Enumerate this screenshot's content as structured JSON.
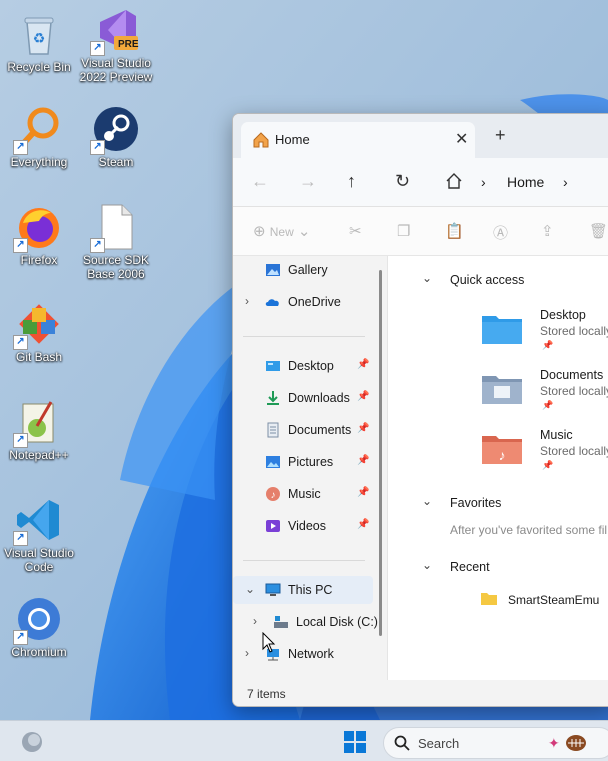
{
  "desktop": {
    "icons": [
      {
        "label": "Recycle Bin",
        "icon": "recycle-bin-icon",
        "shortcut": false
      },
      {
        "label": "Visual Studio 2022 Preview",
        "line1": "Visual Studio",
        "line2": "2022 Preview",
        "badge": "PRE",
        "icon": "visual-studio-icon",
        "shortcut": true
      },
      {
        "label": "Everything",
        "icon": "everything-search-icon",
        "shortcut": true
      },
      {
        "label": "Steam",
        "icon": "steam-icon",
        "shortcut": true
      },
      {
        "label": "Firefox",
        "icon": "firefox-icon",
        "shortcut": true
      },
      {
        "label": "Source SDK Base 2006",
        "line1": "Source SDK",
        "line2": "Base 2006",
        "icon": "blank-file-icon",
        "shortcut": true
      },
      {
        "label": "Git Bash",
        "icon": "git-bash-icon",
        "shortcut": true
      },
      {
        "label": "Notepad++",
        "icon": "notepad-plus-plus-icon",
        "shortcut": true
      },
      {
        "label": "Visual Studio Code",
        "line1": "Visual Studio",
        "line2": "Code",
        "icon": "vscode-icon",
        "shortcut": true
      },
      {
        "label": "Chromium",
        "icon": "chromium-icon",
        "shortcut": true
      }
    ]
  },
  "explorer": {
    "tab_title": "Home",
    "tab_close": "✕",
    "new_tab": "+",
    "breadcrumb": "Home",
    "toolbar_new": "New",
    "nav": {
      "top": [
        {
          "label": "Gallery",
          "icon": "gallery-icon"
        },
        {
          "label": "OneDrive",
          "icon": "onedrive-icon"
        }
      ],
      "pinned": [
        {
          "label": "Desktop",
          "icon": "desktop-folder-icon"
        },
        {
          "label": "Downloads",
          "icon": "downloads-icon"
        },
        {
          "label": "Documents",
          "icon": "documents-icon"
        },
        {
          "label": "Pictures",
          "icon": "pictures-icon"
        },
        {
          "label": "Music",
          "icon": "music-icon"
        },
        {
          "label": "Videos",
          "icon": "videos-icon"
        }
      ],
      "this_pc": "This PC",
      "local_disk": "Local Disk (C:)",
      "network": "Network"
    },
    "content": {
      "quick_access_title": "Quick access",
      "quick_access": [
        {
          "name": "Desktop",
          "sub": "Stored locally",
          "color": "#2f9be8"
        },
        {
          "name": "Documents",
          "sub": "Stored locally",
          "color": "#8aa3c0"
        },
        {
          "name": "Music",
          "sub": "Stored locally",
          "color": "#e57f6b"
        }
      ],
      "favorites_title": "Favorites",
      "favorites_hint": "After you've favorited some fil",
      "recent_title": "Recent",
      "recent_item": "SmartSteamEmu"
    },
    "status": "7 items"
  },
  "taskbar": {
    "search_placeholder": "Search"
  },
  "colors": {
    "accent": "#0067c0",
    "folder_yellow": "#f5c842"
  }
}
